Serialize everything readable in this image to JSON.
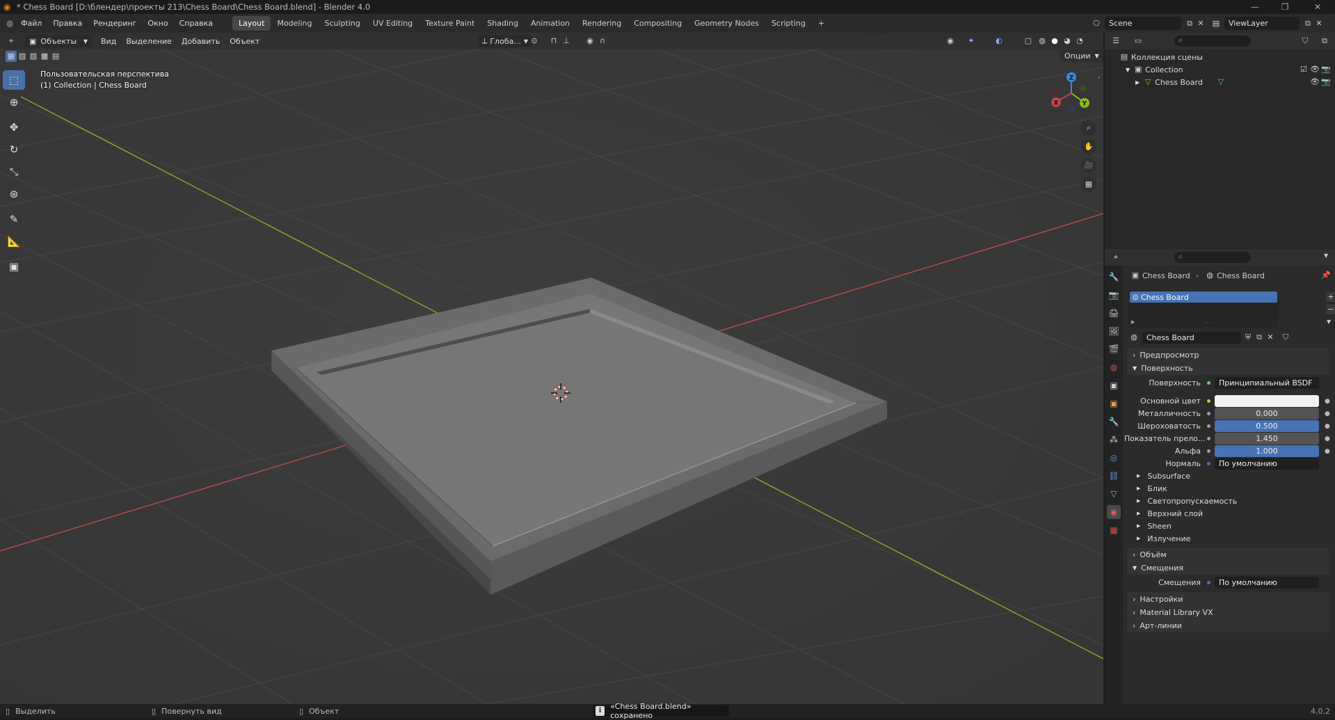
{
  "window": {
    "title": "* Chess Board [D:\\блендер\\проекты 213\\Chess Board\\Chess Board.blend] - Blender 4.0"
  },
  "menu": [
    "Файл",
    "Правка",
    "Рендеринг",
    "Окно",
    "Справка"
  ],
  "workspaces": [
    "Layout",
    "Modeling",
    "Sculpting",
    "UV Editing",
    "Texture Paint",
    "Shading",
    "Animation",
    "Rendering",
    "Compositing",
    "Geometry Nodes",
    "Scripting"
  ],
  "active_workspace": "Layout",
  "topbar_right": {
    "scene": "Scene",
    "view_layer": "ViewLayer"
  },
  "viewport": {
    "mode": "Объекты",
    "menus": [
      "Вид",
      "Выделение",
      "Добавить",
      "Объект"
    ],
    "orientation": "Глоба...",
    "options": "Опции",
    "info_line1": "Пользовательская перспектива",
    "info_line2": "(1) Collection | Chess Board"
  },
  "outliner": {
    "scene_collection": "Коллекция сцены",
    "collection": "Collection",
    "object": "Chess Board"
  },
  "properties": {
    "breadcrumb_object": "Chess Board",
    "breadcrumb_material": "Chess Board",
    "slot": "Chess Board",
    "material_name": "Chess Board",
    "panels": {
      "preview": "Предпросмотр",
      "surface": "Поверхность",
      "volume": "Объём",
      "displacement": "Смещения",
      "settings": "Настройки",
      "matlib": "Material Library VX",
      "lineart": "Арт-линии"
    },
    "surface_label": "Поверхность",
    "surface_value": "Принципиальный BSDF",
    "fields": [
      {
        "label": "Основной цвет",
        "value": ""
      },
      {
        "label": "Металличность",
        "value": "0.000"
      },
      {
        "label": "Шероховатость",
        "value": "0.500"
      },
      {
        "label": "Показатель прело...",
        "value": "1.450"
      },
      {
        "label": "Альфа",
        "value": "1.000"
      },
      {
        "label": "Нормаль",
        "value": "По умолчанию"
      }
    ],
    "subpanels": [
      "Subsurface",
      "Блик",
      "Светопропускаемость",
      "Верхний слой",
      "Sheen",
      "Излучение"
    ],
    "displacement_label": "Смещения",
    "displacement_value": "По умолчанию"
  },
  "statusbar": {
    "select": "Выделить",
    "rotate": "Повернуть вид",
    "object": "Объект",
    "notice": "«Chess Board.blend» сохранено",
    "version": "4.0.2"
  },
  "colors": {
    "accent_blue": "#4772b3",
    "x_axis": "#c8454e",
    "y_axis": "#8cbc1e",
    "z_axis": "#3a8ae0"
  }
}
